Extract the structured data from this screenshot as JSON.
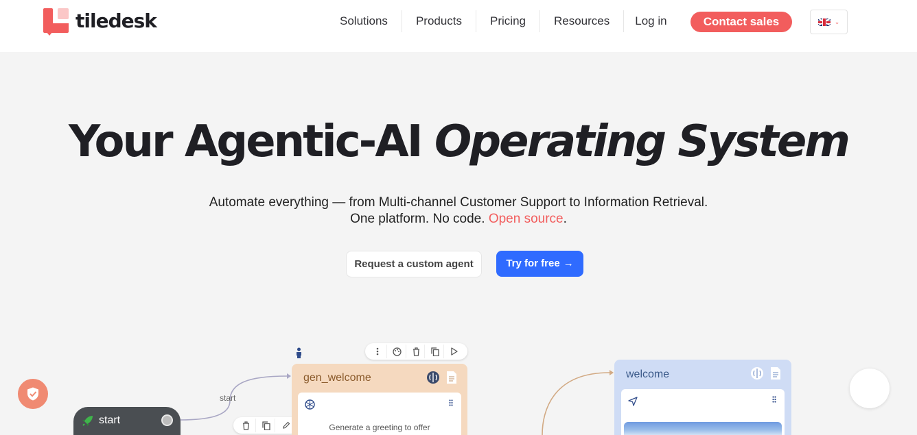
{
  "brand": {
    "name": "tiledesk",
    "accent": "#f25d5d"
  },
  "nav": {
    "items": [
      {
        "label": "Solutions"
      },
      {
        "label": "Products"
      },
      {
        "label": "Pricing"
      },
      {
        "label": "Resources"
      }
    ],
    "login": "Log in",
    "contact": "Contact sales",
    "language": {
      "icon": "uk-flag-icon",
      "chevron": "⌄"
    }
  },
  "hero": {
    "title_plain": "Your Agentic-AI",
    "title_italic": "Operating System",
    "line1": "Automate everything — from Multi-channel Customer Support to Information Retrieval.",
    "line2_prefix": "One platform. No code.",
    "line2_link": "Open source",
    "line2_suffix": ".",
    "btn_custom": "Request a custom agent",
    "btn_try": "Try for free",
    "btn_try_arrow": "→",
    "primary_color": "#2f6bff"
  },
  "flow": {
    "start_node": {
      "label": "start",
      "icon": "rocket-icon"
    },
    "edge_label": "start",
    "gen_card": {
      "title": "gen_welcome",
      "text": "Generate a greeting to offer",
      "color": "#f5d9bf"
    },
    "welcome_card": {
      "title": "welcome",
      "color": "#cfdcf5"
    }
  }
}
